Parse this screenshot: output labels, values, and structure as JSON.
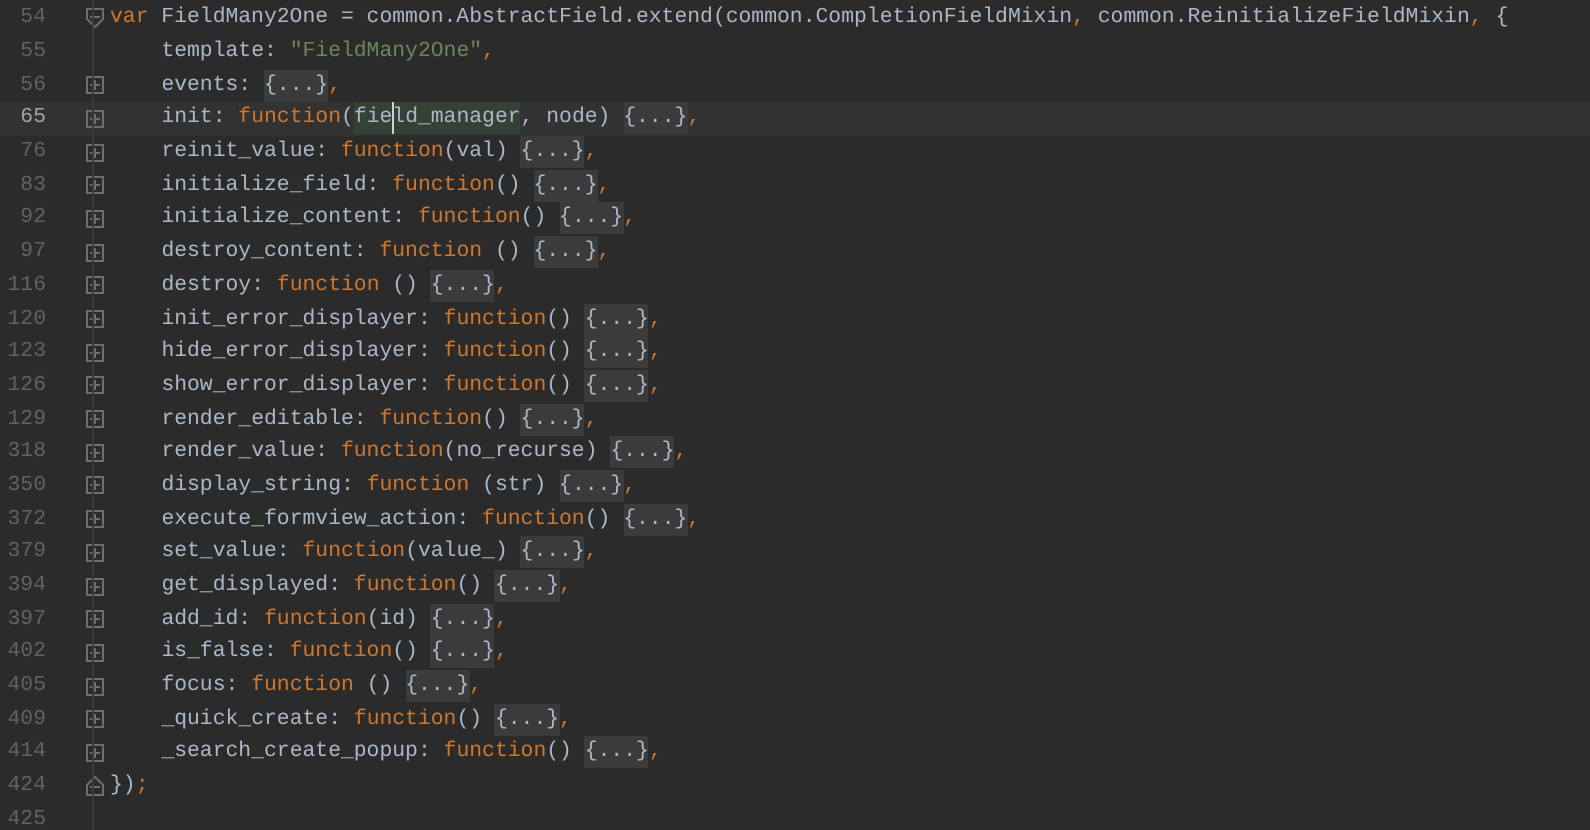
{
  "editor": {
    "lines": [
      {
        "number": "54",
        "expanded": true,
        "current": false,
        "tokens": [
          {
            "kind": "keyword",
            "text": "var"
          },
          {
            "kind": "plain",
            "text": " FieldMany2One = common.AbstractField.extend(common.CompletionFieldMixin"
          },
          {
            "kind": "punct",
            "text": ","
          },
          {
            "kind": "plain",
            "text": " common.ReinitializeFieldMixin"
          },
          {
            "kind": "punct",
            "text": ","
          },
          {
            "kind": "plain",
            "text": " {"
          }
        ],
        "children": [
          {
            "number": "55",
            "current": false,
            "tokens": [
              {
                "kind": "plain",
                "text": "template: "
              },
              {
                "kind": "string",
                "text": "\"FieldMany2One\""
              },
              {
                "kind": "punct",
                "text": ","
              }
            ]
          },
          {
            "number": "56",
            "expanded": false,
            "current": false,
            "tokens": [
              {
                "kind": "plain",
                "text": "events: "
              },
              {
                "kind": "folded",
                "text": "{...}"
              },
              {
                "kind": "punct",
                "text": ","
              }
            ]
          },
          {
            "number": "65",
            "expanded": false,
            "current": true,
            "tokens": [
              {
                "kind": "plain",
                "text": "init: "
              },
              {
                "kind": "keyword",
                "text": "function"
              },
              {
                "kind": "plain",
                "text": "("
              },
              {
                "kind": "usage",
                "text": "fie",
                "caret": false
              },
              {
                "kind": "usage",
                "text": "ld_manager",
                "caret": true
              },
              {
                "kind": "plain",
                "text": ", node) "
              },
              {
                "kind": "folded",
                "text": "{...}"
              },
              {
                "kind": "punct",
                "text": ","
              }
            ]
          },
          {
            "number": "76",
            "expanded": false,
            "current": false,
            "tokens": [
              {
                "kind": "plain",
                "text": "reinit_value: "
              },
              {
                "kind": "keyword",
                "text": "function"
              },
              {
                "kind": "plain",
                "text": "(val) "
              },
              {
                "kind": "folded",
                "text": "{...}"
              },
              {
                "kind": "punct",
                "text": ","
              }
            ]
          },
          {
            "number": "83",
            "expanded": false,
            "current": false,
            "tokens": [
              {
                "kind": "plain",
                "text": "initialize_field: "
              },
              {
                "kind": "keyword",
                "text": "function"
              },
              {
                "kind": "plain",
                "text": "() "
              },
              {
                "kind": "folded",
                "text": "{...}"
              },
              {
                "kind": "punct",
                "text": ","
              }
            ]
          },
          {
            "number": "92",
            "expanded": false,
            "current": false,
            "tokens": [
              {
                "kind": "plain",
                "text": "initialize_content: "
              },
              {
                "kind": "keyword",
                "text": "function"
              },
              {
                "kind": "plain",
                "text": "() "
              },
              {
                "kind": "folded",
                "text": "{...}"
              },
              {
                "kind": "punct",
                "text": ","
              }
            ]
          },
          {
            "number": "97",
            "expanded": false,
            "current": false,
            "tokens": [
              {
                "kind": "plain",
                "text": "destroy_content: "
              },
              {
                "kind": "keyword",
                "text": "function"
              },
              {
                "kind": "plain",
                "text": " () "
              },
              {
                "kind": "folded",
                "text": "{...}"
              },
              {
                "kind": "punct",
                "text": ","
              }
            ]
          },
          {
            "number": "116",
            "expanded": false,
            "current": false,
            "tokens": [
              {
                "kind": "plain",
                "text": "destroy: "
              },
              {
                "kind": "keyword",
                "text": "function"
              },
              {
                "kind": "plain",
                "text": " () "
              },
              {
                "kind": "folded",
                "text": "{...}"
              },
              {
                "kind": "punct",
                "text": ","
              }
            ]
          },
          {
            "number": "120",
            "expanded": false,
            "current": false,
            "tokens": [
              {
                "kind": "plain",
                "text": "init_error_displayer: "
              },
              {
                "kind": "keyword",
                "text": "function"
              },
              {
                "kind": "plain",
                "text": "() "
              },
              {
                "kind": "folded",
                "text": "{...}"
              },
              {
                "kind": "punct",
                "text": ","
              }
            ]
          },
          {
            "number": "123",
            "expanded": false,
            "current": false,
            "tokens": [
              {
                "kind": "plain",
                "text": "hide_error_displayer: "
              },
              {
                "kind": "keyword",
                "text": "function"
              },
              {
                "kind": "plain",
                "text": "() "
              },
              {
                "kind": "folded",
                "text": "{...}"
              },
              {
                "kind": "punct",
                "text": ","
              }
            ]
          },
          {
            "number": "126",
            "expanded": false,
            "current": false,
            "tokens": [
              {
                "kind": "plain",
                "text": "show_error_displayer: "
              },
              {
                "kind": "keyword",
                "text": "function"
              },
              {
                "kind": "plain",
                "text": "() "
              },
              {
                "kind": "folded",
                "text": "{...}"
              },
              {
                "kind": "punct",
                "text": ","
              }
            ]
          },
          {
            "number": "129",
            "expanded": false,
            "current": false,
            "tokens": [
              {
                "kind": "plain",
                "text": "render_editable: "
              },
              {
                "kind": "keyword",
                "text": "function"
              },
              {
                "kind": "plain",
                "text": "() "
              },
              {
                "kind": "folded",
                "text": "{...}"
              },
              {
                "kind": "punct",
                "text": ","
              }
            ]
          },
          {
            "number": "318",
            "expanded": false,
            "current": false,
            "tokens": [
              {
                "kind": "plain",
                "text": "render_value: "
              },
              {
                "kind": "keyword",
                "text": "function"
              },
              {
                "kind": "plain",
                "text": "(no_recurse) "
              },
              {
                "kind": "folded",
                "text": "{...}"
              },
              {
                "kind": "punct",
                "text": ","
              }
            ]
          },
          {
            "number": "350",
            "expanded": false,
            "current": false,
            "tokens": [
              {
                "kind": "plain",
                "text": "display_string: "
              },
              {
                "kind": "keyword",
                "text": "function"
              },
              {
                "kind": "plain",
                "text": " (str) "
              },
              {
                "kind": "folded",
                "text": "{...}"
              },
              {
                "kind": "punct",
                "text": ","
              }
            ]
          },
          {
            "number": "372",
            "expanded": false,
            "current": false,
            "tokens": [
              {
                "kind": "plain",
                "text": "execute_formview_action: "
              },
              {
                "kind": "keyword",
                "text": "function"
              },
              {
                "kind": "plain",
                "text": "() "
              },
              {
                "kind": "folded",
                "text": "{...}"
              },
              {
                "kind": "punct",
                "text": ","
              }
            ]
          },
          {
            "number": "379",
            "expanded": false,
            "current": false,
            "tokens": [
              {
                "kind": "plain",
                "text": "set_value: "
              },
              {
                "kind": "keyword",
                "text": "function"
              },
              {
                "kind": "plain",
                "text": "(value_) "
              },
              {
                "kind": "folded",
                "text": "{...}"
              },
              {
                "kind": "punct",
                "text": ","
              }
            ]
          },
          {
            "number": "394",
            "expanded": false,
            "current": false,
            "tokens": [
              {
                "kind": "plain",
                "text": "get_displayed: "
              },
              {
                "kind": "keyword",
                "text": "function"
              },
              {
                "kind": "plain",
                "text": "() "
              },
              {
                "kind": "folded",
                "text": "{...}"
              },
              {
                "kind": "punct",
                "text": ","
              }
            ]
          },
          {
            "number": "397",
            "expanded": false,
            "current": false,
            "tokens": [
              {
                "kind": "plain",
                "text": "add_id: "
              },
              {
                "kind": "keyword",
                "text": "function"
              },
              {
                "kind": "plain",
                "text": "(id) "
              },
              {
                "kind": "folded",
                "text": "{...}"
              },
              {
                "kind": "punct",
                "text": ","
              }
            ]
          },
          {
            "number": "402",
            "expanded": false,
            "current": false,
            "tokens": [
              {
                "kind": "plain",
                "text": "is_false: "
              },
              {
                "kind": "keyword",
                "text": "function"
              },
              {
                "kind": "plain",
                "text": "() "
              },
              {
                "kind": "folded",
                "text": "{...}"
              },
              {
                "kind": "punct",
                "text": ","
              }
            ]
          },
          {
            "number": "405",
            "expanded": false,
            "current": false,
            "tokens": [
              {
                "kind": "plain",
                "text": "focus: "
              },
              {
                "kind": "keyword",
                "text": "function"
              },
              {
                "kind": "plain",
                "text": " () "
              },
              {
                "kind": "folded",
                "text": "{...}"
              },
              {
                "kind": "punct",
                "text": ","
              }
            ]
          },
          {
            "number": "409",
            "expanded": false,
            "current": false,
            "tokens": [
              {
                "kind": "plain",
                "text": "_quick_create: "
              },
              {
                "kind": "keyword",
                "text": "function"
              },
              {
                "kind": "plain",
                "text": "() "
              },
              {
                "kind": "folded",
                "text": "{...}"
              },
              {
                "kind": "punct",
                "text": ","
              }
            ]
          },
          {
            "number": "414",
            "expanded": false,
            "current": false,
            "tokens": [
              {
                "kind": "plain",
                "text": "_search_create_popup: "
              },
              {
                "kind": "keyword",
                "text": "function"
              },
              {
                "kind": "plain",
                "text": "() "
              },
              {
                "kind": "folded",
                "text": "{...}"
              },
              {
                "kind": "punct",
                "text": ","
              }
            ]
          }
        ]
      },
      {
        "number": "424",
        "fold_end": true,
        "current": false,
        "tokens": [
          {
            "kind": "plain",
            "text": "})"
          },
          {
            "kind": "punct",
            "text": ";"
          }
        ]
      },
      {
        "number": "425",
        "current": false
      }
    ]
  }
}
